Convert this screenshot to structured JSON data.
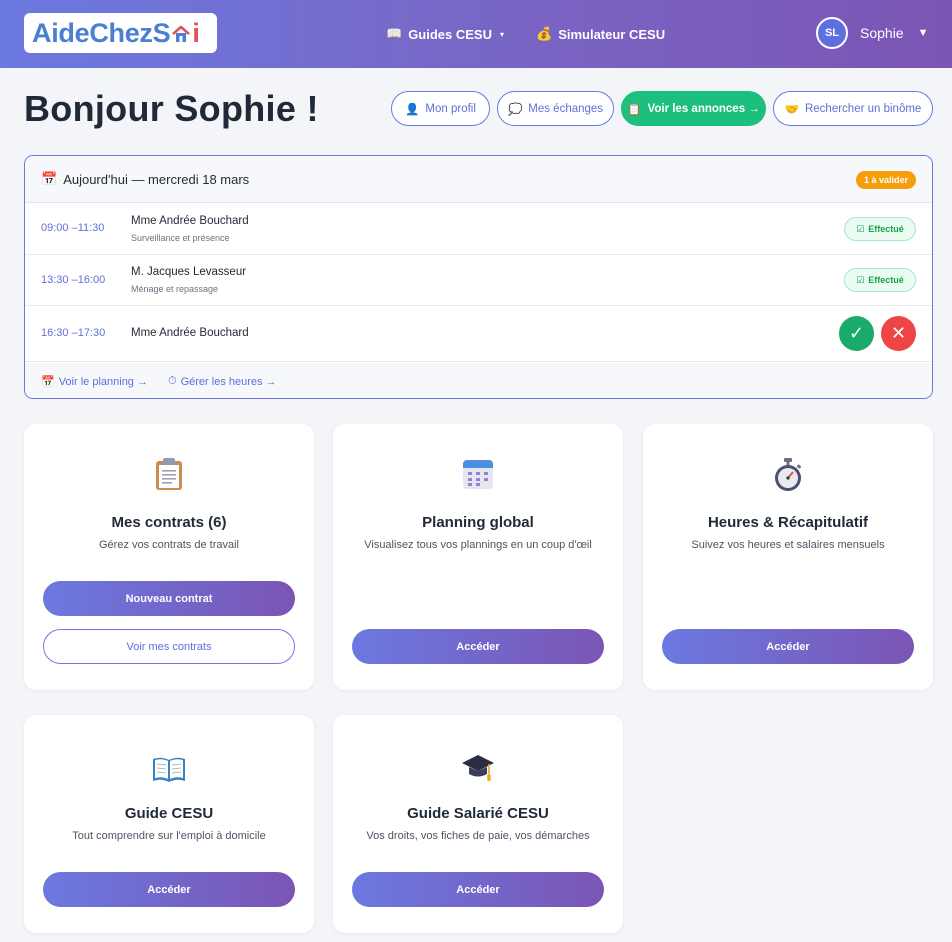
{
  "header": {
    "logo": {
      "part1": "Aide",
      "part2": "Chez",
      "part3_start": "S",
      "part3_end": "i"
    },
    "nav": [
      {
        "icon": "book-icon",
        "label": "Guides CESU",
        "has_dropdown": true
      },
      {
        "icon": "money-bag-icon",
        "label": "Simulateur CESU",
        "has_dropdown": false
      }
    ],
    "user": {
      "initials": "SL",
      "name": "Sophie"
    }
  },
  "greeting": "Bonjour Sophie !",
  "quick_actions": [
    {
      "icon": "person-icon",
      "label": "Mon profil"
    },
    {
      "icon": "speech-bubble-icon",
      "label": "Mes échanges"
    },
    {
      "icon": "clipboard-icon",
      "label": "Voir les annonces →"
    },
    {
      "icon": "handshake-icon",
      "label": "Rechercher un binôme"
    }
  ],
  "today": {
    "title": "Aujourd'hui — mercredi 18 mars",
    "badge": "1 à valider",
    "rows": [
      {
        "time": "09:00 –11:30",
        "name": "Mme Andrée Bouchard",
        "task": "Surveillance et présence",
        "status": "Effectué"
      },
      {
        "time": "13:30 –16:00",
        "name": "M. Jacques Levasseur",
        "task": "Ménage et repassage",
        "status": "Effectué"
      },
      {
        "time": "16:30 –17:30",
        "name": "Mme Andrée Bouchard",
        "task": "",
        "status": ""
      }
    ],
    "validate_symbol": "✓",
    "reject_symbol": "✕",
    "footer_links": [
      {
        "icon": "calendar-icon",
        "label": "Voir le planning →"
      },
      {
        "icon": "stopwatch-icon",
        "label": "Gérer les heures →"
      }
    ]
  },
  "cards": [
    {
      "icon": "clipboard-icon",
      "title": "Mes contrats (6)",
      "desc": "Gérez vos contrats de travail",
      "primary": "Nouveau contrat",
      "secondary": "Voir mes contrats"
    },
    {
      "icon": "calendar-icon",
      "title": "Planning global",
      "desc": "Visualisez tous vos plannings en un coup d'œil",
      "primary": "Accéder"
    },
    {
      "icon": "stopwatch-icon",
      "title": "Heures & Récapitulatif",
      "desc": "Suivez vos heures et salaires mensuels",
      "primary": "Accéder"
    },
    {
      "icon": "open-book-icon",
      "title": "Guide CESU",
      "desc": "Tout comprendre sur l'emploi à domicile",
      "primary": "Accéder"
    },
    {
      "icon": "graduation-cap-icon",
      "title": "Guide Salarié CESU",
      "desc": "Vos droits, vos fiches de paie, vos démarches",
      "primary": "Accéder"
    }
  ],
  "colors": {
    "brand_gradient_start": "#6b79e0",
    "brand_gradient_end": "#7b55b4",
    "success": "#1dbf7e",
    "danger": "#ef4444",
    "warning": "#f59e0b"
  }
}
